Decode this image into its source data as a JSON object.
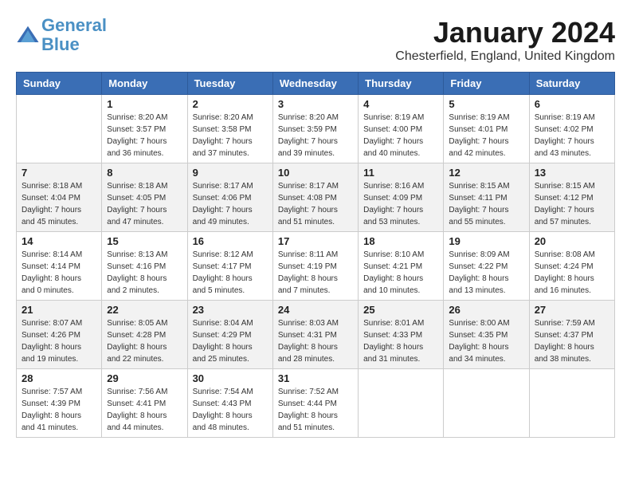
{
  "header": {
    "logo_line1": "General",
    "logo_line2": "Blue",
    "month": "January 2024",
    "location": "Chesterfield, England, United Kingdom"
  },
  "weekdays": [
    "Sunday",
    "Monday",
    "Tuesday",
    "Wednesday",
    "Thursday",
    "Friday",
    "Saturday"
  ],
  "weeks": [
    [
      {
        "day": "",
        "sunrise": "",
        "sunset": "",
        "daylight": ""
      },
      {
        "day": "1",
        "sunrise": "8:20 AM",
        "sunset": "3:57 PM",
        "daylight": "7 hours and 36 minutes."
      },
      {
        "day": "2",
        "sunrise": "8:20 AM",
        "sunset": "3:58 PM",
        "daylight": "7 hours and 37 minutes."
      },
      {
        "day": "3",
        "sunrise": "8:20 AM",
        "sunset": "3:59 PM",
        "daylight": "7 hours and 39 minutes."
      },
      {
        "day": "4",
        "sunrise": "8:19 AM",
        "sunset": "4:00 PM",
        "daylight": "7 hours and 40 minutes."
      },
      {
        "day": "5",
        "sunrise": "8:19 AM",
        "sunset": "4:01 PM",
        "daylight": "7 hours and 42 minutes."
      },
      {
        "day": "6",
        "sunrise": "8:19 AM",
        "sunset": "4:02 PM",
        "daylight": "7 hours and 43 minutes."
      }
    ],
    [
      {
        "day": "7",
        "sunrise": "8:18 AM",
        "sunset": "4:04 PM",
        "daylight": "7 hours and 45 minutes."
      },
      {
        "day": "8",
        "sunrise": "8:18 AM",
        "sunset": "4:05 PM",
        "daylight": "7 hours and 47 minutes."
      },
      {
        "day": "9",
        "sunrise": "8:17 AM",
        "sunset": "4:06 PM",
        "daylight": "7 hours and 49 minutes."
      },
      {
        "day": "10",
        "sunrise": "8:17 AM",
        "sunset": "4:08 PM",
        "daylight": "7 hours and 51 minutes."
      },
      {
        "day": "11",
        "sunrise": "8:16 AM",
        "sunset": "4:09 PM",
        "daylight": "7 hours and 53 minutes."
      },
      {
        "day": "12",
        "sunrise": "8:15 AM",
        "sunset": "4:11 PM",
        "daylight": "7 hours and 55 minutes."
      },
      {
        "day": "13",
        "sunrise": "8:15 AM",
        "sunset": "4:12 PM",
        "daylight": "7 hours and 57 minutes."
      }
    ],
    [
      {
        "day": "14",
        "sunrise": "8:14 AM",
        "sunset": "4:14 PM",
        "daylight": "8 hours and 0 minutes."
      },
      {
        "day": "15",
        "sunrise": "8:13 AM",
        "sunset": "4:16 PM",
        "daylight": "8 hours and 2 minutes."
      },
      {
        "day": "16",
        "sunrise": "8:12 AM",
        "sunset": "4:17 PM",
        "daylight": "8 hours and 5 minutes."
      },
      {
        "day": "17",
        "sunrise": "8:11 AM",
        "sunset": "4:19 PM",
        "daylight": "8 hours and 7 minutes."
      },
      {
        "day": "18",
        "sunrise": "8:10 AM",
        "sunset": "4:21 PM",
        "daylight": "8 hours and 10 minutes."
      },
      {
        "day": "19",
        "sunrise": "8:09 AM",
        "sunset": "4:22 PM",
        "daylight": "8 hours and 13 minutes."
      },
      {
        "day": "20",
        "sunrise": "8:08 AM",
        "sunset": "4:24 PM",
        "daylight": "8 hours and 16 minutes."
      }
    ],
    [
      {
        "day": "21",
        "sunrise": "8:07 AM",
        "sunset": "4:26 PM",
        "daylight": "8 hours and 19 minutes."
      },
      {
        "day": "22",
        "sunrise": "8:05 AM",
        "sunset": "4:28 PM",
        "daylight": "8 hours and 22 minutes."
      },
      {
        "day": "23",
        "sunrise": "8:04 AM",
        "sunset": "4:29 PM",
        "daylight": "8 hours and 25 minutes."
      },
      {
        "day": "24",
        "sunrise": "8:03 AM",
        "sunset": "4:31 PM",
        "daylight": "8 hours and 28 minutes."
      },
      {
        "day": "25",
        "sunrise": "8:01 AM",
        "sunset": "4:33 PM",
        "daylight": "8 hours and 31 minutes."
      },
      {
        "day": "26",
        "sunrise": "8:00 AM",
        "sunset": "4:35 PM",
        "daylight": "8 hours and 34 minutes."
      },
      {
        "day": "27",
        "sunrise": "7:59 AM",
        "sunset": "4:37 PM",
        "daylight": "8 hours and 38 minutes."
      }
    ],
    [
      {
        "day": "28",
        "sunrise": "7:57 AM",
        "sunset": "4:39 PM",
        "daylight": "8 hours and 41 minutes."
      },
      {
        "day": "29",
        "sunrise": "7:56 AM",
        "sunset": "4:41 PM",
        "daylight": "8 hours and 44 minutes."
      },
      {
        "day": "30",
        "sunrise": "7:54 AM",
        "sunset": "4:43 PM",
        "daylight": "8 hours and 48 minutes."
      },
      {
        "day": "31",
        "sunrise": "7:52 AM",
        "sunset": "4:44 PM",
        "daylight": "8 hours and 51 minutes."
      },
      {
        "day": "",
        "sunrise": "",
        "sunset": "",
        "daylight": ""
      },
      {
        "day": "",
        "sunrise": "",
        "sunset": "",
        "daylight": ""
      },
      {
        "day": "",
        "sunrise": "",
        "sunset": "",
        "daylight": ""
      }
    ]
  ]
}
